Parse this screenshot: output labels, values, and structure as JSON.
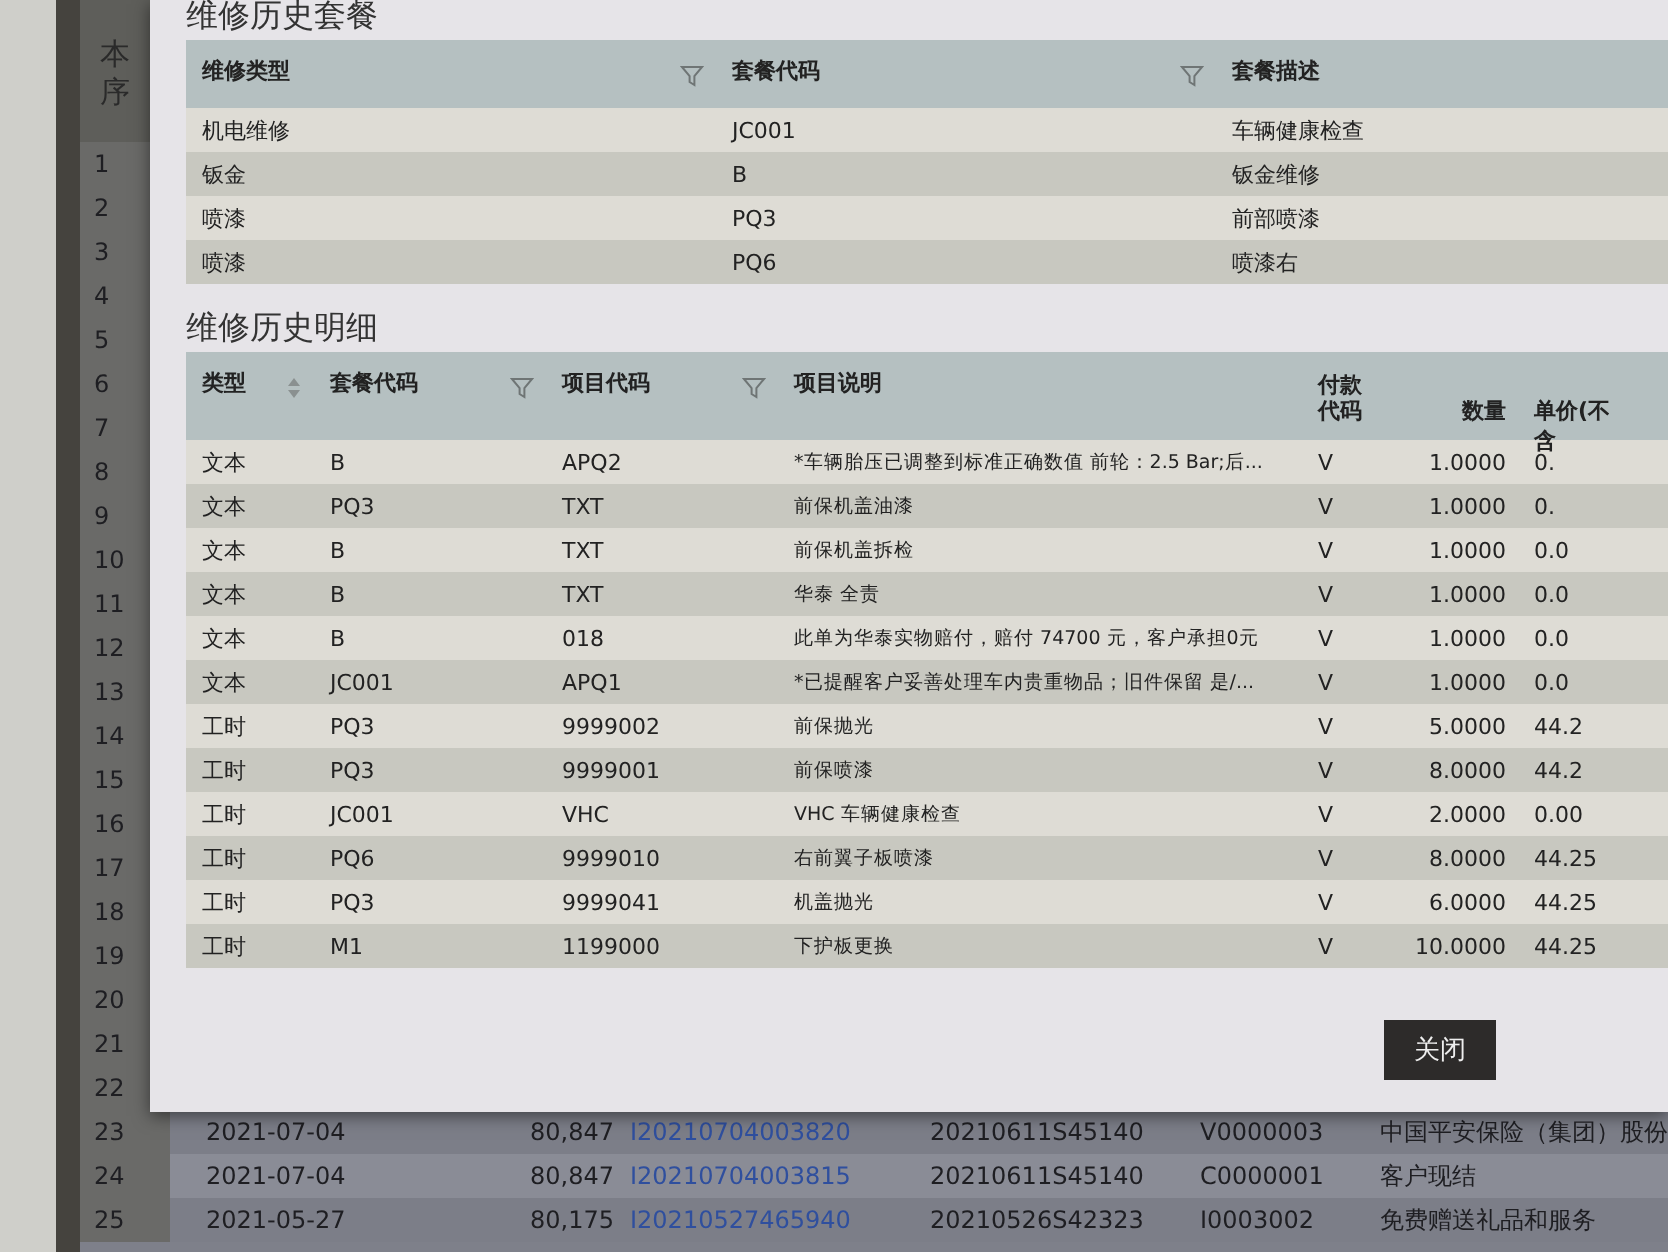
{
  "background": {
    "top_fragment": "本",
    "number_header": "序",
    "rows": [
      {
        "no": "1"
      },
      {
        "no": "2"
      },
      {
        "no": "3"
      },
      {
        "no": "4"
      },
      {
        "no": "5"
      },
      {
        "no": "6"
      },
      {
        "no": "7"
      },
      {
        "no": "8"
      },
      {
        "no": "9"
      },
      {
        "no": "10"
      },
      {
        "no": "11"
      },
      {
        "no": "12"
      },
      {
        "no": "13"
      },
      {
        "no": "14"
      },
      {
        "no": "15"
      },
      {
        "no": "16"
      },
      {
        "no": "17"
      },
      {
        "no": "18"
      },
      {
        "no": "19"
      },
      {
        "no": "20"
      },
      {
        "no": "21"
      },
      {
        "no": "22"
      },
      {
        "no": "23",
        "date": "2021-07-04",
        "amount": "80,847",
        "invoice": "I20210704003820",
        "order": "20210611S45140",
        "code": "V0000003",
        "customer": "中国平安保险（集团）股份"
      },
      {
        "no": "24",
        "date": "2021-07-04",
        "amount": "80,847",
        "invoice": "I20210704003815",
        "order": "20210611S45140",
        "code": "C0000001",
        "customer": "客户现结"
      },
      {
        "no": "25",
        "date": "2021-05-27",
        "amount": "80,175",
        "invoice": "I20210527465940",
        "order": "20210526S42323",
        "code": "I0003002",
        "customer": "免费赠送礼品和服务"
      }
    ]
  },
  "dialog": {
    "package_section": {
      "title": "维修历史套餐",
      "columns": [
        {
          "label": "维修类型",
          "filter": true
        },
        {
          "label": "套餐代码",
          "filter": true
        },
        {
          "label": "套餐描述"
        }
      ],
      "rows": [
        [
          "机电维修",
          "JC001",
          "车辆健康检查"
        ],
        [
          "钣金",
          "B",
          "钣金维修"
        ],
        [
          "喷漆",
          "PQ3",
          "前部喷漆"
        ],
        [
          "喷漆",
          "PQ6",
          "喷漆右"
        ]
      ]
    },
    "detail_section": {
      "title": "维修历史明细",
      "columns": [
        {
          "label": "类型",
          "sort": true
        },
        {
          "label": "套餐代码",
          "filter": true
        },
        {
          "label": "项目代码",
          "filter": true
        },
        {
          "label": "项目说明"
        },
        {
          "label": "付款代码"
        },
        {
          "label": "数量"
        },
        {
          "label": "单价(不含"
        }
      ],
      "rows": [
        [
          "文本",
          "B",
          "APQ2",
          "*车辆胎压已调整到标准正确数值 前轮：2.5 Bar;后...",
          "V",
          "1.0000",
          "0."
        ],
        [
          "文本",
          "PQ3",
          "TXT",
          "前保机盖油漆",
          "V",
          "1.0000",
          "0."
        ],
        [
          "文本",
          "B",
          "TXT",
          "前保机盖拆检",
          "V",
          "1.0000",
          "0.0"
        ],
        [
          "文本",
          "B",
          "TXT",
          "华泰 全责",
          "V",
          "1.0000",
          "0.0"
        ],
        [
          "文本",
          "B",
          "018",
          "此单为华泰实物赔付，赔付 74700 元，客户承担0元",
          "V",
          "1.0000",
          "0.0"
        ],
        [
          "文本",
          "JC001",
          "APQ1",
          "*已提醒客户妥善处理车内贵重物品；旧件保留 是/...",
          "V",
          "1.0000",
          "0.0"
        ],
        [
          "工时",
          "PQ3",
          "9999002",
          "前保抛光",
          "V",
          "5.0000",
          "44.2"
        ],
        [
          "工时",
          "PQ3",
          "9999001",
          "前保喷漆",
          "V",
          "8.0000",
          "44.2"
        ],
        [
          "工时",
          "JC001",
          "VHC",
          "VHC 车辆健康检查",
          "V",
          "2.0000",
          "0.00"
        ],
        [
          "工时",
          "PQ6",
          "9999010",
          "右前翼子板喷漆",
          "V",
          "8.0000",
          "44.25"
        ],
        [
          "工时",
          "PQ3",
          "9999041",
          "机盖抛光",
          "V",
          "6.0000",
          "44.25"
        ],
        [
          "工时",
          "M1",
          "1199000",
          "下护板更换",
          "V",
          "10.0000",
          "44.25"
        ]
      ]
    },
    "buttons": [
      {
        "label": "关闭"
      }
    ]
  }
}
